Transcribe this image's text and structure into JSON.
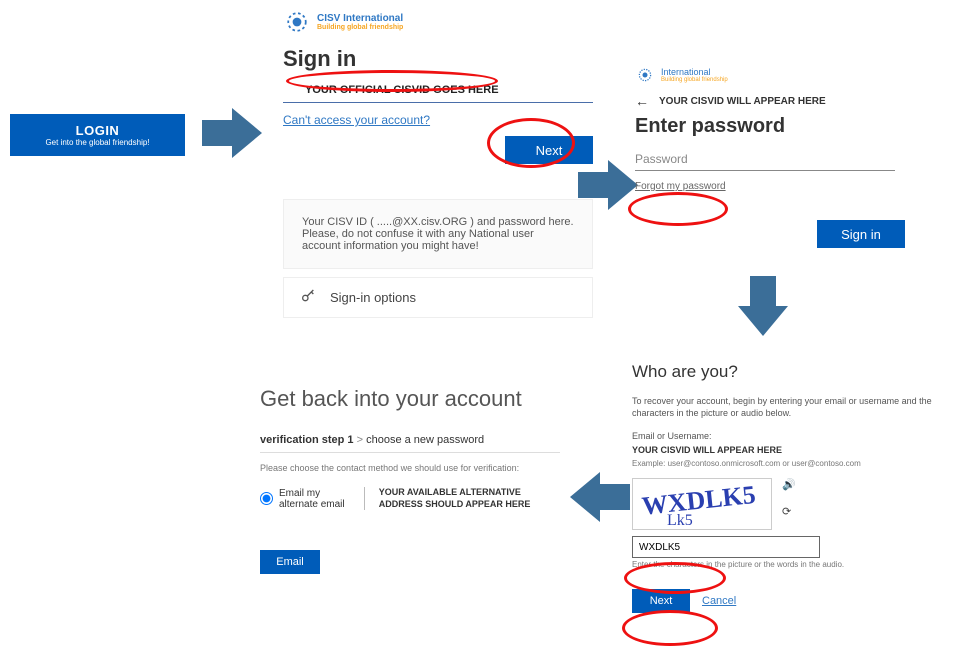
{
  "login_button": {
    "title": "LOGIN",
    "subtitle": "Get into the global friendship!"
  },
  "brand": {
    "name": "CISV International",
    "tagline": "Building global friendship"
  },
  "signin": {
    "title": "Sign in",
    "input_placeholder": "YOUR OFFICIAL CISVID GOES HERE",
    "cant_access": "Can't access your account?",
    "next_label": "Next",
    "notice": "Your CISV ID ( .....@XX.cisv.ORG ) and password here. Please, do not confuse it with any National user account information you might have!",
    "options_label": "Sign-in options"
  },
  "password_step": {
    "brand_suffix": "International",
    "id_line": "YOUR CISVID WILL APPEAR HERE",
    "title": "Enter password",
    "placeholder": "Password",
    "forgot": "Forgot my password",
    "signin_label": "Sign in"
  },
  "who": {
    "title": "Who are you?",
    "intro": "To recover your account, begin by entering your email or username and the characters in the picture or audio below.",
    "field_label": "Email or Username:",
    "uid": "YOUR CISVID WILL APPEAR HERE",
    "example": "Example: user@contoso.onmicrosoft.com or user@contoso.com",
    "captcha_text": "WXDLK5",
    "captcha_value": "WXDLK5",
    "captcha_help": "Enter the characters in the picture or the words in the audio.",
    "next_label": "Next",
    "cancel_label": "Cancel"
  },
  "recovery": {
    "title": "Get back into your account",
    "step_bold": "verification step 1",
    "step_rest": "choose a new password",
    "contact_intro": "Please choose the contact method we should use for verification:",
    "option_label": "Email my alternate email",
    "alt_address": "YOUR AVAILABLE ALTERNATIVE ADDRESS SHOULD APPEAR HERE",
    "email_label": "Email"
  }
}
